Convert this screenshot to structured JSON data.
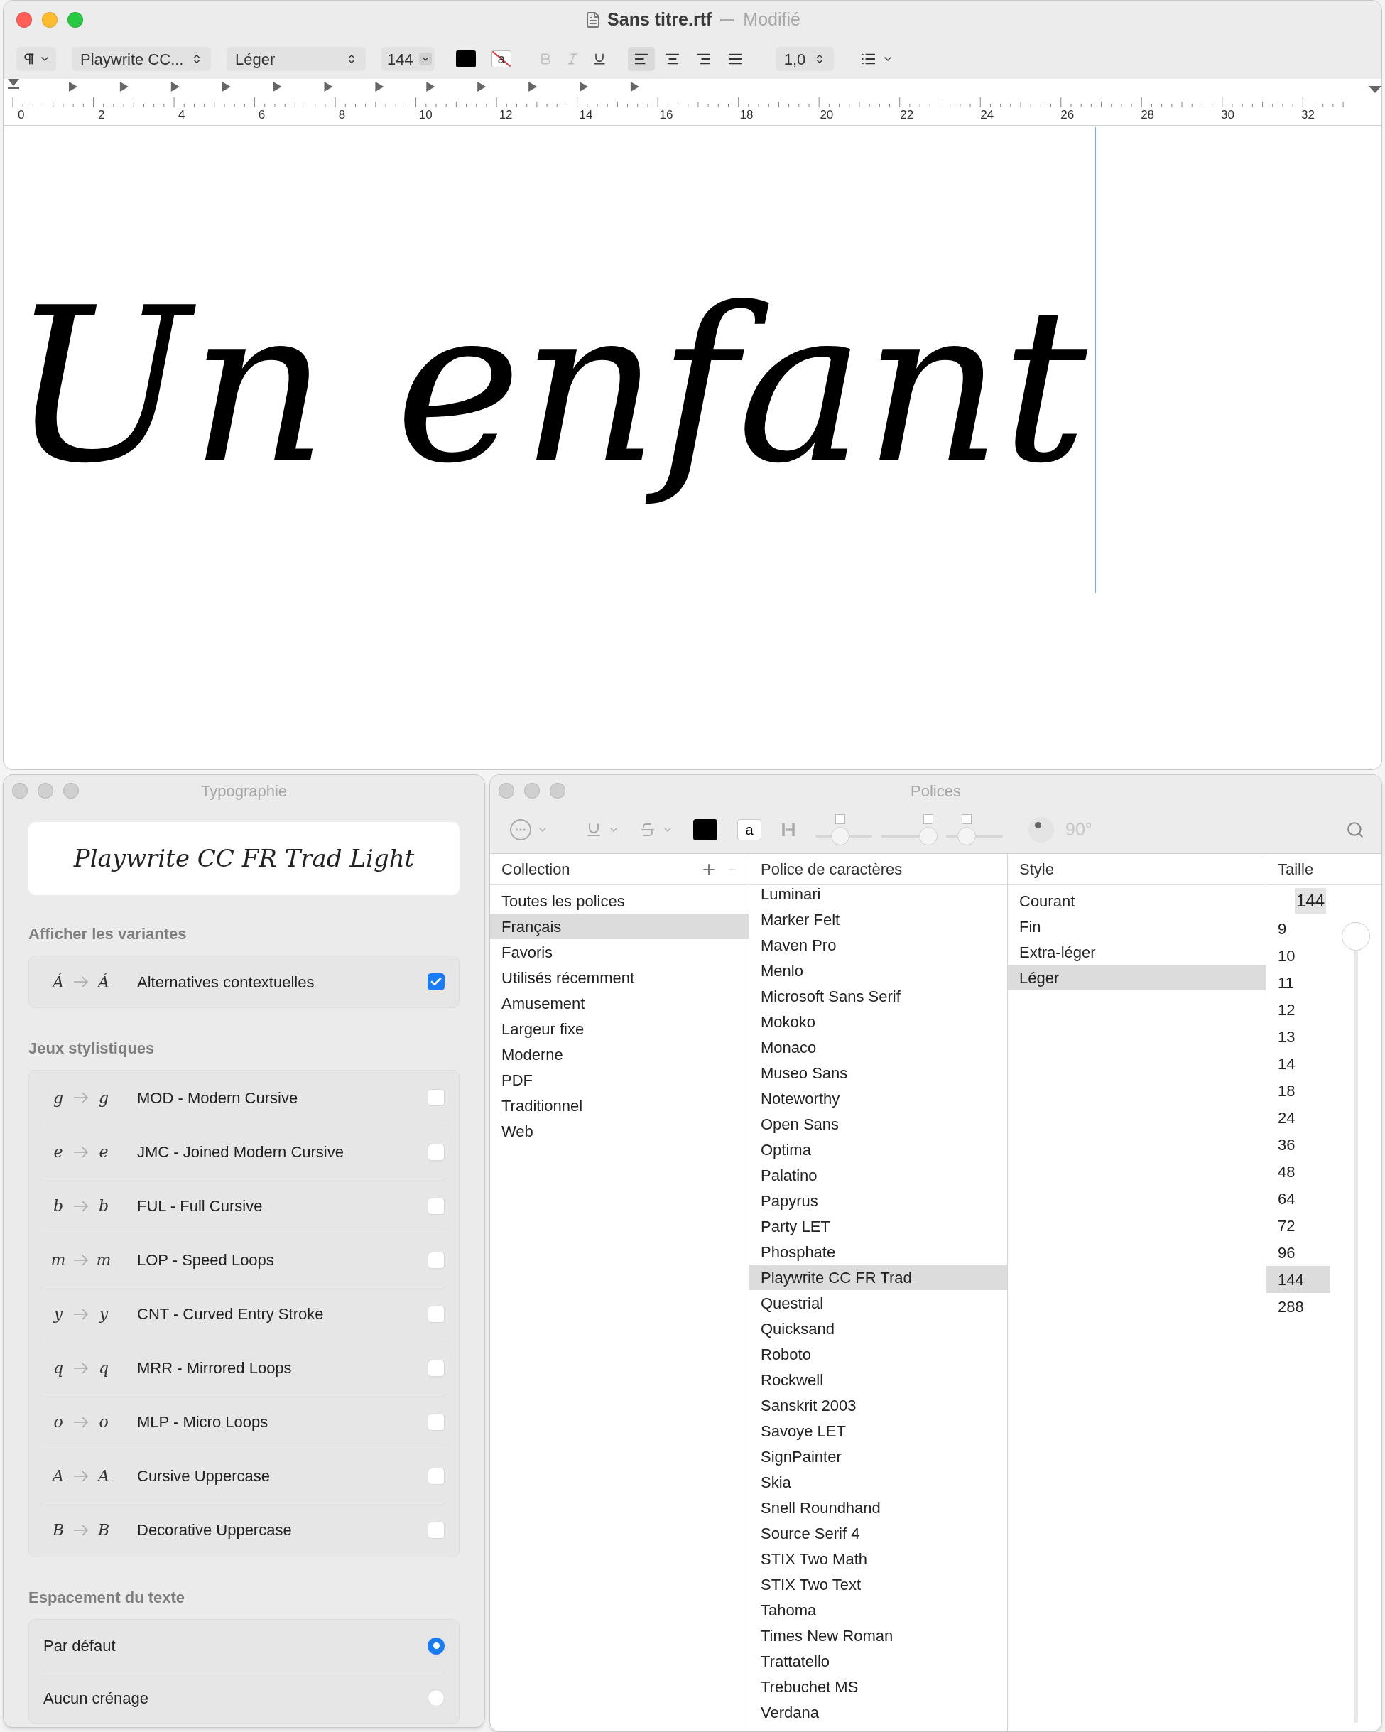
{
  "document_window": {
    "title": "Sans titre.rtf",
    "status": "Modifié"
  },
  "toolbar": {
    "font": "Playwrite CC...",
    "style": "Léger",
    "size": "144",
    "background_letter": "a",
    "format_buttons": [
      {
        "kind": "bold",
        "disabled": true
      },
      {
        "kind": "italic",
        "disabled": true
      },
      {
        "kind": "underline",
        "disabled": false
      }
    ],
    "alignments": [
      {
        "kind": "left",
        "selected": true
      },
      {
        "kind": "center",
        "selected": false
      },
      {
        "kind": "right",
        "selected": false
      },
      {
        "kind": "justify",
        "selected": false
      }
    ],
    "line_spacing": "1,0"
  },
  "ruler": {
    "labels": [
      "0",
      "2",
      "4",
      "6",
      "8",
      "10",
      "12",
      "14",
      "16",
      "18",
      "20",
      "22",
      "24",
      "26",
      "28",
      "30",
      "32"
    ]
  },
  "document": {
    "text": "Un enfant"
  },
  "typography_panel": {
    "title": "Typographie",
    "preview": "Playwrite CC FR Trad Light",
    "sections": [
      {
        "heading": "Afficher les variantes",
        "items": [
          {
            "kind": "checkbox",
            "from": "Á",
            "to": "Á",
            "label": "Alternatives contextuelles",
            "checked": true
          }
        ]
      },
      {
        "heading": "Jeux stylistiques",
        "items": [
          {
            "kind": "checkbox",
            "from": "g",
            "to": "g",
            "label": "MOD - Modern Cursive",
            "checked": false
          },
          {
            "kind": "checkbox",
            "from": "e",
            "to": "e",
            "label": "JMC - Joined Modern Cursive",
            "checked": false
          },
          {
            "kind": "checkbox",
            "from": "b",
            "to": "b",
            "label": "FUL - Full Cursive",
            "checked": false
          },
          {
            "kind": "checkbox",
            "from": "m",
            "to": "m",
            "label": "LOP - Speed Loops",
            "checked": false
          },
          {
            "kind": "checkbox",
            "from": "y",
            "to": "y",
            "label": "CNT - Curved Entry Stroke",
            "checked": false
          },
          {
            "kind": "checkbox",
            "from": "q",
            "to": "q",
            "label": "MRR - Mirrored Loops",
            "checked": false
          },
          {
            "kind": "checkbox",
            "from": "o",
            "to": "o",
            "label": "MLP - Micro Loops",
            "checked": false
          },
          {
            "kind": "checkbox",
            "from": "A",
            "to": "A",
            "label": "Cursive Uppercase",
            "checked": false
          },
          {
            "kind": "checkbox",
            "from": "B",
            "to": "B",
            "label": "Decorative Uppercase",
            "checked": false
          }
        ]
      },
      {
        "heading": "Espacement du texte",
        "items": [
          {
            "kind": "radio",
            "label": "Par défaut",
            "selected": true
          },
          {
            "kind": "radio",
            "label": "Aucun crénage",
            "selected": false
          }
        ]
      }
    ]
  },
  "fonts_panel": {
    "title": "Polices",
    "toolbar": {
      "document_letter": "a",
      "sliders": [
        {
          "level": 0.4
        },
        {
          "level": 1.0
        },
        {
          "level": 0.3
        }
      ],
      "angle": "90°"
    },
    "columns": [
      "Collection",
      "Police de caractères",
      "Style",
      "Taille"
    ],
    "collections": [
      {
        "label": "Toutes les polices",
        "selected": false
      },
      {
        "label": "Français",
        "selected": true
      },
      {
        "label": "Favoris",
        "selected": false
      },
      {
        "label": "Utilisés récemment",
        "selected": false
      },
      {
        "label": "Amusement",
        "selected": false
      },
      {
        "label": "Largeur fixe",
        "selected": false
      },
      {
        "label": "Moderne",
        "selected": false
      },
      {
        "label": "PDF",
        "selected": false
      },
      {
        "label": "Traditionnel",
        "selected": false
      },
      {
        "label": "Web",
        "selected": false
      }
    ],
    "fonts": [
      {
        "label": "Luminari",
        "selected": false
      },
      {
        "label": "Marker Felt",
        "selected": false
      },
      {
        "label": "Maven Pro",
        "selected": false
      },
      {
        "label": "Menlo",
        "selected": false
      },
      {
        "label": "Microsoft Sans Serif",
        "selected": false
      },
      {
        "label": "Mokoko",
        "selected": false
      },
      {
        "label": "Monaco",
        "selected": false
      },
      {
        "label": "Museo Sans",
        "selected": false
      },
      {
        "label": "Noteworthy",
        "selected": false
      },
      {
        "label": "Open Sans",
        "selected": false
      },
      {
        "label": "Optima",
        "selected": false
      },
      {
        "label": "Palatino",
        "selected": false
      },
      {
        "label": "Papyrus",
        "selected": false
      },
      {
        "label": "Party LET",
        "selected": false
      },
      {
        "label": "Phosphate",
        "selected": false
      },
      {
        "label": "Playwrite CC FR Trad",
        "selected": true
      },
      {
        "label": "Questrial",
        "selected": false
      },
      {
        "label": "Quicksand",
        "selected": false
      },
      {
        "label": "Roboto",
        "selected": false
      },
      {
        "label": "Rockwell",
        "selected": false
      },
      {
        "label": "Sanskrit 2003",
        "selected": false
      },
      {
        "label": "Savoye LET",
        "selected": false
      },
      {
        "label": "SignPainter",
        "selected": false
      },
      {
        "label": "Skia",
        "selected": false
      },
      {
        "label": "Snell Roundhand",
        "selected": false
      },
      {
        "label": "Source Serif 4",
        "selected": false
      },
      {
        "label": "STIX Two Math",
        "selected": false
      },
      {
        "label": "STIX Two Text",
        "selected": false
      },
      {
        "label": "Tahoma",
        "selected": false
      },
      {
        "label": "Times New Roman",
        "selected": false
      },
      {
        "label": "Trattatello",
        "selected": false
      },
      {
        "label": "Trebuchet MS",
        "selected": false
      },
      {
        "label": "Verdana",
        "selected": false
      }
    ],
    "styles": [
      {
        "label": "Courant",
        "selected": false
      },
      {
        "label": "Fin",
        "selected": false
      },
      {
        "label": "Extra-léger",
        "selected": false
      },
      {
        "label": "Léger",
        "selected": true
      }
    ],
    "size_field": "144",
    "size_slider": {
      "level": 0
    },
    "sizes": [
      {
        "label": "9",
        "selected": false
      },
      {
        "label": "10",
        "selected": false
      },
      {
        "label": "11",
        "selected": false
      },
      {
        "label": "12",
        "selected": false
      },
      {
        "label": "13",
        "selected": false
      },
      {
        "label": "14",
        "selected": false
      },
      {
        "label": "18",
        "selected": false
      },
      {
        "label": "24",
        "selected": false
      },
      {
        "label": "36",
        "selected": false
      },
      {
        "label": "48",
        "selected": false
      },
      {
        "label": "64",
        "selected": false
      },
      {
        "label": "72",
        "selected": false
      },
      {
        "label": "96",
        "selected": false
      },
      {
        "label": "144",
        "selected": true
      },
      {
        "label": "288",
        "selected": false
      }
    ]
  }
}
